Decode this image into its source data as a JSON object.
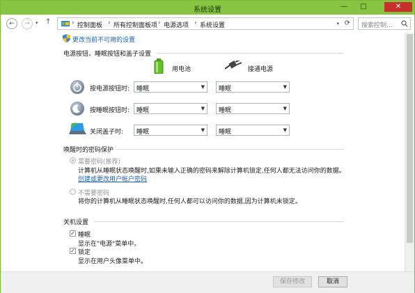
{
  "window": {
    "title": "系统设置",
    "minimize": "—",
    "maximize": "□",
    "close": "✕"
  },
  "nav": {
    "back": "←",
    "forward": "→",
    "up": "↑",
    "refresh": "⟳"
  },
  "breadcrumbs": [
    "控制面板",
    "所有控制面板项",
    "电源选项",
    "系统设置"
  ],
  "breadcrumb_sep": "›",
  "search": {
    "placeholder": "搜索控制..."
  },
  "shield_link": "更改当前不可用的设置",
  "power_section": {
    "title": "电源按钮、睡眠按钮和盖子设置",
    "col_battery": "用电池",
    "col_plugged": "接通电源",
    "rows": [
      {
        "label": "按电源按钮时:",
        "battery": "睡眠",
        "plugged": "睡眠"
      },
      {
        "label": "按睡眠按钮时:",
        "battery": "睡眠",
        "plugged": "睡眠"
      },
      {
        "label": "关闭盖子时:",
        "battery": "睡眠",
        "plugged": "睡眠"
      }
    ]
  },
  "password_section": {
    "title": "唤醒时的密码保护",
    "opt1_label": "需要密码(推荐)",
    "opt1_desc": "计算机从睡眠状态唤醒时,如果未输入正确的密码来解除计算机锁定,任何人都无法访问你的数据。",
    "opt1_link": "创建或更改用户帐户密码",
    "opt2_label": "不需要密码",
    "opt2_desc": "将你的计算机从睡眠状态唤醒时,任何人都可以访问你的数据,因为计算机未锁定。"
  },
  "shutdown_section": {
    "title": "关机设置",
    "items": [
      {
        "label": "睡眠",
        "desc": "显示在\"电源\"菜单中。",
        "checked": true
      },
      {
        "label": "锁定",
        "desc": "显示在用户头像菜单中。",
        "checked": true
      }
    ]
  },
  "footer": {
    "save": "保存修改",
    "cancel": "取消"
  }
}
